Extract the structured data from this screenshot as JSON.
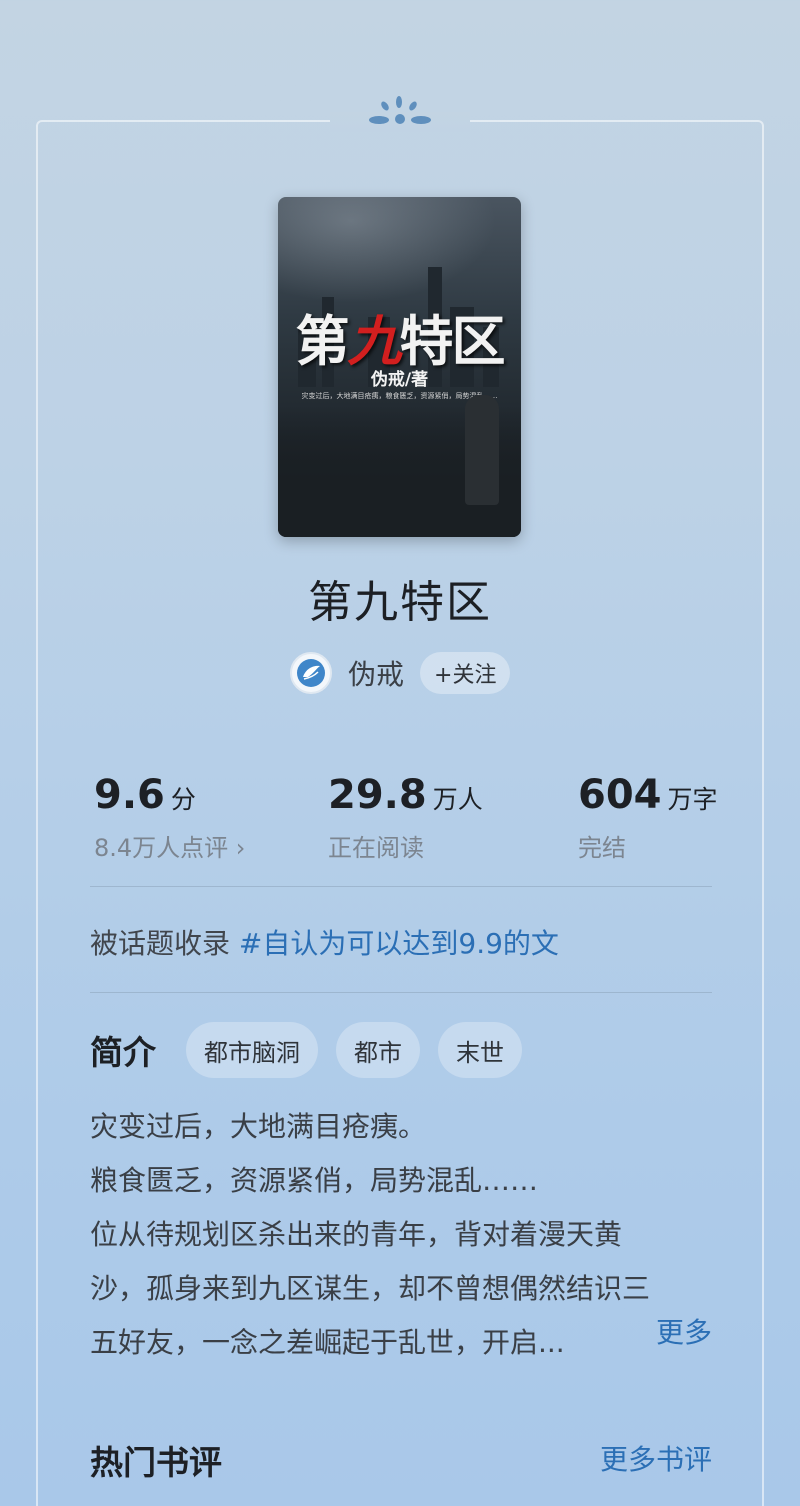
{
  "book": {
    "title": "第九特区",
    "cover": {
      "title_prefix": "第",
      "title_accent": "九",
      "title_suffix": "特区",
      "author": "伪戒/著",
      "blurb": "灾变过后，大地满目疮痍，粮食匮乏，资源紧俏，局势混乱……"
    },
    "author": "伪戒",
    "follow_label": "+关注"
  },
  "stats": [
    {
      "value": "9.6",
      "unit": "分",
      "sub": "8.4万人点评 ›"
    },
    {
      "value": "29.8",
      "unit": "万人",
      "sub": "正在阅读"
    },
    {
      "value": "604",
      "unit": "万字",
      "sub": "完结"
    }
  ],
  "topic": {
    "prefix": "被话题收录",
    "hashtag": "#自认为可以达到9.9的文"
  },
  "intro": {
    "label": "简介",
    "tags": [
      "都市脑洞",
      "都市",
      "末世"
    ],
    "lines": [
      "灾变过后，大地满目疮痍。",
      "粮食匮乏，资源紧俏，局势混乱……",
      "位从待规划区杀出来的青年，背对着漫天黄",
      "沙，孤身来到九区谋生，却不曾想偶然结识三",
      "五好友，一念之差崛起于乱世，开启..."
    ],
    "more_label": "更多"
  },
  "reviews": {
    "label": "热门书评",
    "more_label": "更多书评"
  },
  "colors": {
    "accent": "#2b6fb5",
    "text_primary": "#1d2025",
    "text_secondary": "#7c8590"
  }
}
